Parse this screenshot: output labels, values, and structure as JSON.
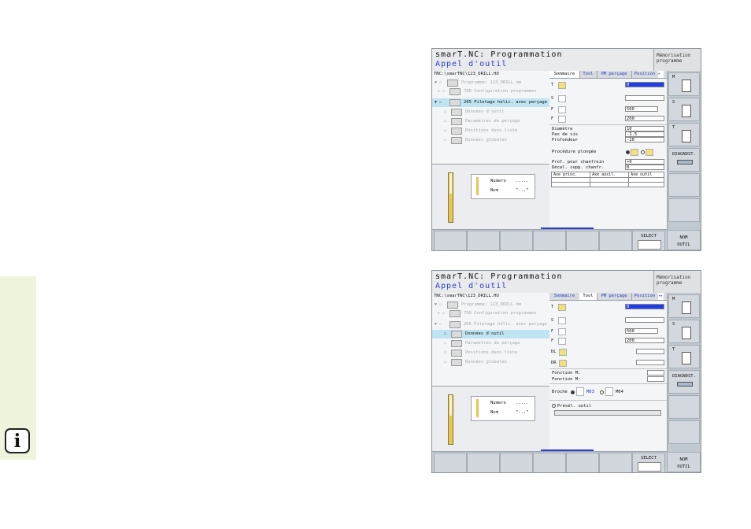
{
  "screen1": {
    "title": "smarT.NC: Programmation",
    "subtitle": "Appel d'outil",
    "mem_line1": "Mémorisation",
    "mem_line2": "programme",
    "path": "TNC:\\smarTNC\\123_DRILL.HU",
    "tree": [
      {
        "exp": "▼ ☐",
        "label": "Programme: 123_DRILL mm"
      },
      {
        "exp": "▸ ☐",
        "label": "700 Configuration programmes"
      },
      {
        "exp": "▼ ☐",
        "label": "205 Filetage hélic. avec perçage"
      },
      {
        "exp": "☐",
        "label": "Données d'outil"
      },
      {
        "exp": "☐",
        "label": "Paramètres de perçage"
      },
      {
        "exp": "☐",
        "label": "Positions dans liste"
      },
      {
        "exp": "☐",
        "label": "Données globales"
      }
    ],
    "tool_card": {
      "numero_label": "Numero",
      "numero_value": ".....",
      "nom_label": "Nom",
      "nom_value": "\"...\""
    },
    "tabs": [
      "Sommaire",
      "Tool",
      "PM perçage",
      "Position"
    ],
    "tab_arrow": "▸",
    "fields": {
      "t_label": "T",
      "t_value": "0",
      "s_label": "S",
      "s_value": "",
      "f1_label": "F",
      "f1_value": "500",
      "f2_label": "F",
      "f2_value": "200"
    },
    "params": [
      {
        "label": "Diamètre",
        "value": "10"
      },
      {
        "label": "Pas de vis",
        "value": "-1.5"
      },
      {
        "label": "Profondeur",
        "value": "-10"
      }
    ],
    "procedure_label": "Procédure plongée",
    "chamfer": [
      {
        "label": "Prof. pour chanfrein",
        "value": "+0"
      },
      {
        "label": "Décal. supp. chanfr.",
        "value": "0"
      }
    ],
    "axes_headers": [
      "Axe princ.",
      "Axe auxil.",
      "Axe outil"
    ],
    "softkeys": {
      "select_label": "SELECT",
      "nom_outil_line1": "NOM",
      "nom_outil_line2": "OUTIL"
    },
    "right_buttons": {
      "m_label": "M",
      "s_label": "S",
      "t_label": "T",
      "diag_label": "DIAGNOST."
    }
  },
  "screen2": {
    "title": "smarT.NC: Programmation",
    "subtitle": "Appel d'outil",
    "mem_line1": "Mémorisation",
    "mem_line2": "programme",
    "path": "TNC:\\smarTNC\\123_DRILL.HU",
    "tree": [
      {
        "exp": "▼ ☐",
        "label": "Programme: 123_DRILL mm"
      },
      {
        "exp": "▸ ☐",
        "label": "700 Configuration programmes"
      },
      {
        "exp": "▼ ☐",
        "label": "205 Filetage hélic. avec perçage"
      },
      {
        "exp": "☐",
        "label": "Données d'outil"
      },
      {
        "exp": "☐",
        "label": "Paramètres de perçage"
      },
      {
        "exp": "☐",
        "label": "Positions dans liste"
      },
      {
        "exp": "☐",
        "label": "Données globales"
      }
    ],
    "tool_card": {
      "numero_label": "Numero",
      "numero_value": ".....",
      "nom_label": "Nom",
      "nom_value": "\"...\""
    },
    "tabs": [
      "Sommaire",
      "Tool",
      "PM perçage",
      "Position"
    ],
    "tab_arrow": "◂▸",
    "fields": {
      "t_label": "T",
      "t_value": "0",
      "s_label": "S",
      "s_value": "",
      "f1_label": "F",
      "f1_value": "500",
      "f2_label": "F",
      "f2_value": "200",
      "dl_label": "DL",
      "dr_label": "DR"
    },
    "fonction1_label": "Fonction M:",
    "fonction2_label": "Fonction M:",
    "broche_label": "Broche",
    "m03_label": "M03",
    "m04_label": "M04",
    "presel_label": "Présél. outil",
    "softkeys": {
      "select_label": "SELECT",
      "nom_outil_line1": "NOM",
      "nom_outil_line2": "OUTIL"
    },
    "right_buttons": {
      "m_label": "M",
      "s_label": "S",
      "t_label": "T",
      "diag_label": "DIAGNOST."
    }
  },
  "info_icon_glyph": "i"
}
